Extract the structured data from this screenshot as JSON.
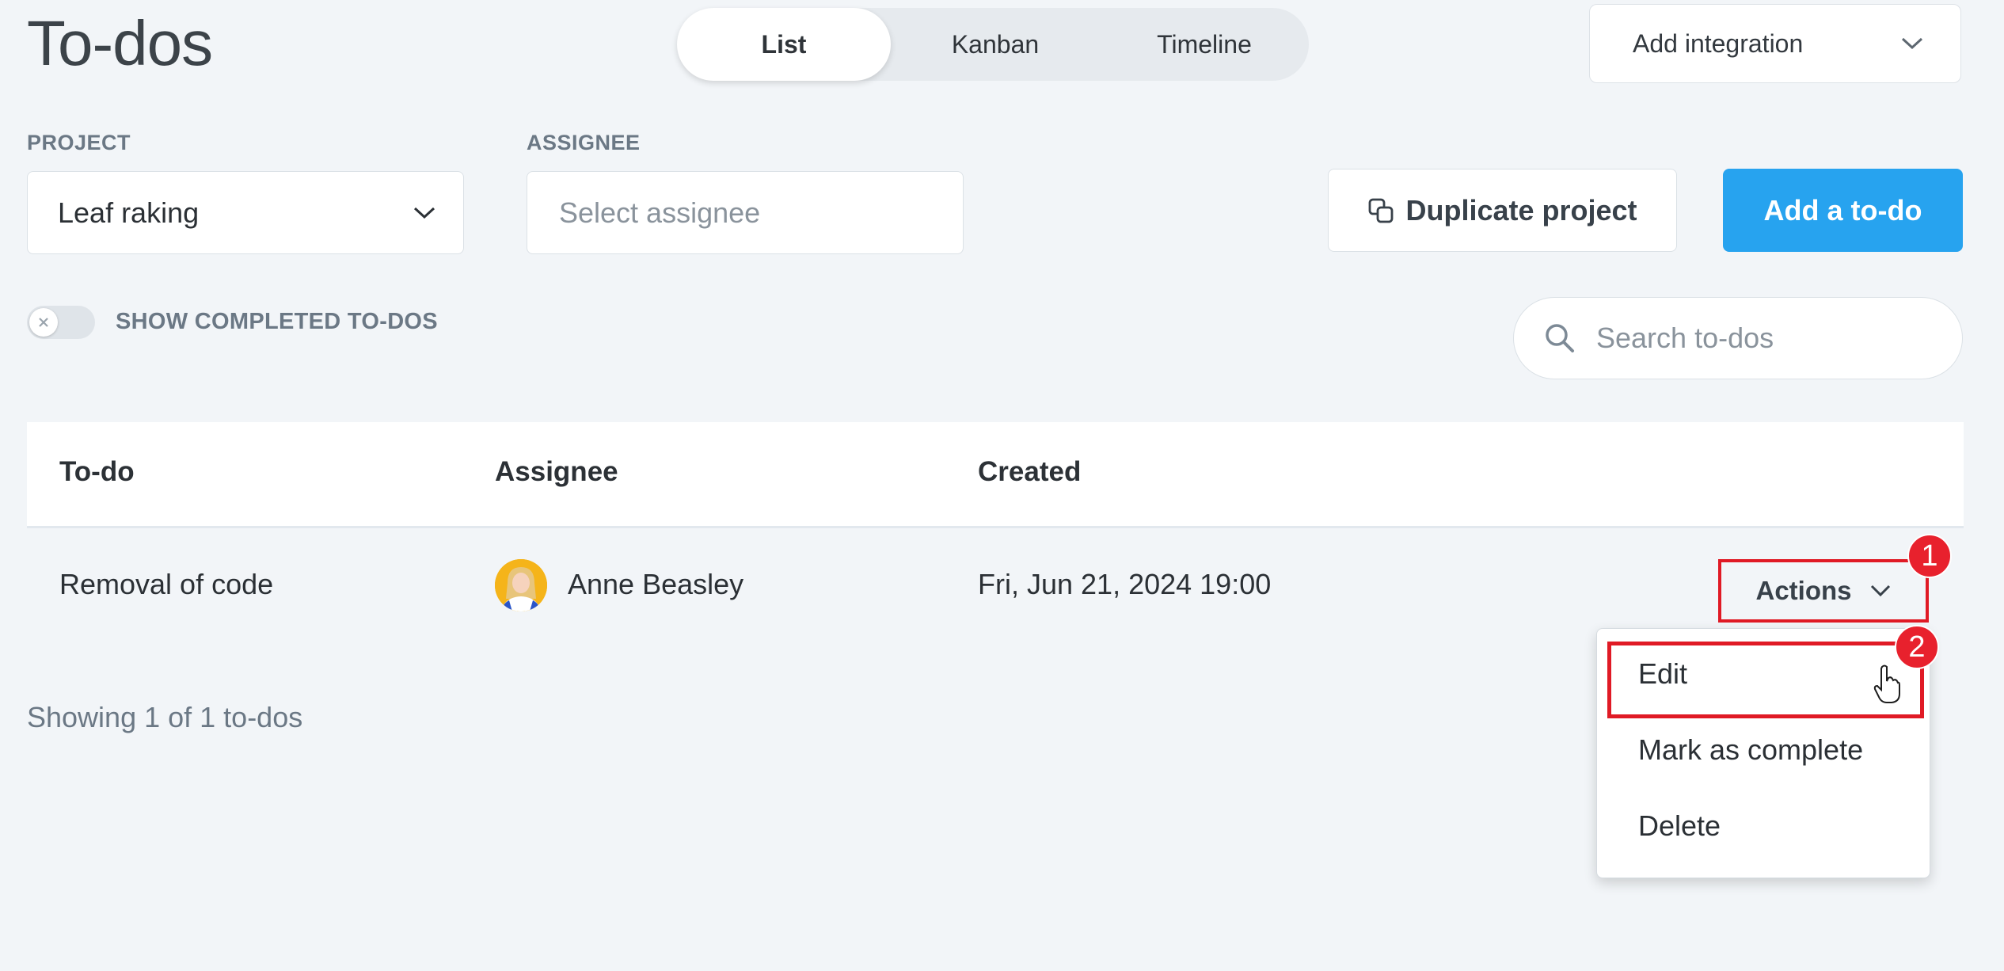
{
  "page": {
    "title": "To-dos"
  },
  "view_tabs": [
    "List",
    "Kanban",
    "Timeline"
  ],
  "integration": {
    "label": "Add integration"
  },
  "filters": {
    "project_label": "PROJECT",
    "project_value": "Leaf raking",
    "assignee_label": "ASSIGNEE",
    "assignee_placeholder": "Select assignee"
  },
  "buttons": {
    "duplicate": "Duplicate project",
    "add": "Add a to-do"
  },
  "toggle": {
    "label": "SHOW COMPLETED TO-DOS",
    "on": false
  },
  "search": {
    "placeholder": "Search to-dos"
  },
  "table": {
    "headers": [
      "To-do",
      "Assignee",
      "Created"
    ],
    "rows": [
      {
        "todo": "Removal of code",
        "assignee": "Anne Beasley",
        "created": "Fri, Jun 21, 2024 19:00",
        "actions": "Actions"
      }
    ]
  },
  "menu": {
    "items": [
      "Edit",
      "Mark as complete",
      "Delete"
    ]
  },
  "footer": {
    "count": "Showing 1 of 1 to-dos"
  },
  "annotations": {
    "badge1": "1",
    "badge2": "2"
  },
  "colors": {
    "accent": "#27a3ef",
    "highlight": "#e01a25",
    "background": "#f2f5f8"
  }
}
